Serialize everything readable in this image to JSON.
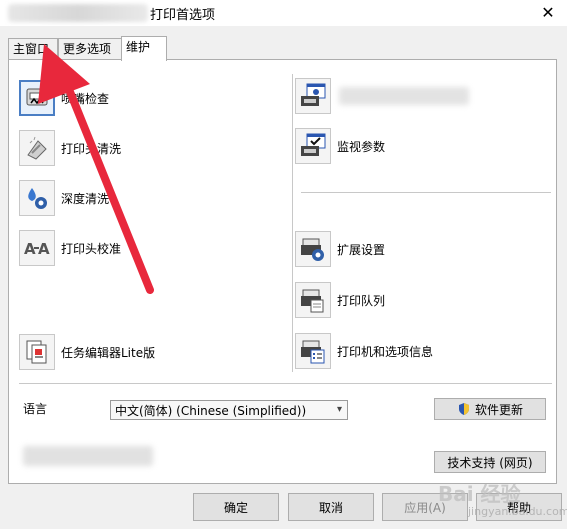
{
  "window": {
    "title": "打印首选项",
    "close_glyph": "✕"
  },
  "tabs": [
    {
      "label": "主窗口"
    },
    {
      "label": "更多选项"
    },
    {
      "label": "维护"
    }
  ],
  "maintenance": {
    "left_items": [
      {
        "label": "喷嘴检查",
        "icon": "nozzle-check-icon"
      },
      {
        "label": "打印头清洗",
        "icon": "head-cleaning-icon"
      },
      {
        "label": "深度清洗",
        "icon": "power-cleaning-icon"
      },
      {
        "label": "打印头校准",
        "icon": "print-head-alignment-icon"
      },
      {
        "label": "任务编辑器Lite版",
        "icon": "job-arranger-icon"
      }
    ],
    "right_items": [
      {
        "label": "",
        "icon": "status-monitor-icon"
      },
      {
        "label": "监视参数",
        "icon": "monitoring-preferences-icon"
      },
      {
        "label": "扩展设置",
        "icon": "extended-settings-icon"
      },
      {
        "label": "打印队列",
        "icon": "print-queue-icon"
      },
      {
        "label": "打印机和选项信息",
        "icon": "printer-info-icon"
      }
    ]
  },
  "language": {
    "label": "语言",
    "selected": "中文(简体) (Chinese (Simplified))"
  },
  "software_update_label": "软件更新",
  "tech_support_label": "技术支持 (网页)",
  "footer": {
    "ok": "确定",
    "cancel": "取消",
    "apply": "应用(A)",
    "help": "帮助"
  },
  "watermark": {
    "text": "Bai 经验",
    "sub": "jingyan.baidu.com"
  },
  "colors": {
    "accent_arrow": "#e8283c",
    "selected_border": "#4a7ec4"
  }
}
